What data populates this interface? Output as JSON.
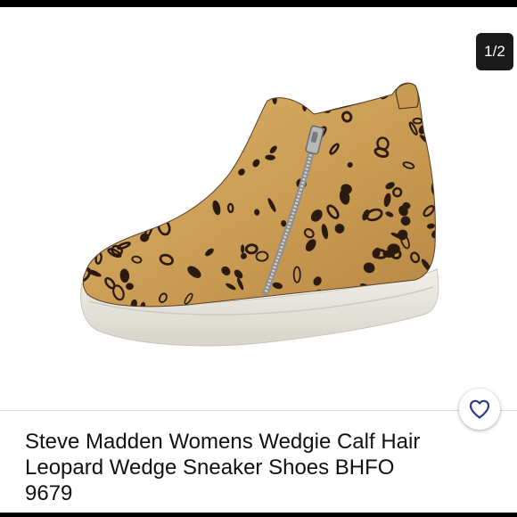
{
  "gallery": {
    "image_alt": "leopard print high-top wedge sneaker",
    "page_indicator": "1/2"
  },
  "product": {
    "title": "Steve Madden Womens Wedgie Calf Hair Leopard Wedge Sneaker Shoes BHFO 9679"
  },
  "icons": {
    "like": "heart-outline-icon"
  },
  "colors": {
    "accent": "#2b3a86",
    "indicator_bg": "#1a1a1a",
    "leopard_base": "#cf9f55",
    "spot": "#2a1a10",
    "sole": "#e9e6df"
  }
}
